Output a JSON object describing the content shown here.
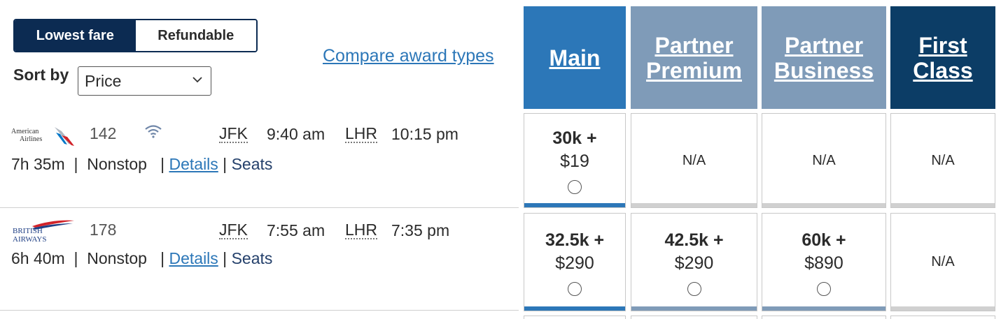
{
  "fare_toggle": {
    "lowest_label": "Lowest fare",
    "refundable_label": "Refundable"
  },
  "sort": {
    "label": "Sort by",
    "selected": "Price"
  },
  "compare_link": "Compare award types",
  "columns": [
    {
      "line1": "Main",
      "line2": "",
      "color": "#2c77b8"
    },
    {
      "line1": "Partner",
      "line2": "Premium",
      "color": "#7f9bb8"
    },
    {
      "line1": "Partner",
      "line2": "Business",
      "color": "#7f9bb8"
    },
    {
      "line1": "First",
      "line2": "Class",
      "color": "#0c3d66"
    }
  ],
  "flights": [
    {
      "airline_logo": "american-airlines-logo",
      "logo_text": [
        "American",
        "Airlines"
      ],
      "flight_number": "142",
      "wifi": true,
      "origin": "JFK",
      "depart": "9:40 am",
      "destination": "LHR",
      "arrive": "10:15 pm",
      "duration": "7h 35m",
      "stops": "Nonstop",
      "details_label": "Details",
      "seats_label": "Seats",
      "fares": [
        {
          "miles": "30k +",
          "cash": "$19",
          "available": true
        },
        {
          "na": "N/A",
          "available": false
        },
        {
          "na": "N/A",
          "available": false
        },
        {
          "na": "N/A",
          "available": false
        }
      ]
    },
    {
      "airline_logo": "british-airways-logo",
      "logo_text": [
        "BRITISH",
        "AIRWAYS"
      ],
      "flight_number": "178",
      "wifi": false,
      "origin": "JFK",
      "depart": "7:55 am",
      "destination": "LHR",
      "arrive": "7:35 pm",
      "duration": "6h 40m",
      "stops": "Nonstop",
      "details_label": "Details",
      "seats_label": "Seats",
      "fares": [
        {
          "miles": "32.5k +",
          "cash": "$290",
          "available": true
        },
        {
          "miles": "42.5k +",
          "cash": "$290",
          "available": true
        },
        {
          "miles": "60k +",
          "cash": "$890",
          "available": true
        },
        {
          "na": "N/A",
          "available": false
        }
      ]
    }
  ],
  "colors": {
    "navy": "#0c2b52",
    "link": "#2c77b8",
    "bar_main": "#2c77b8",
    "bar_partner": "#7f9bb8",
    "bar_none": "#d0d0d0"
  }
}
